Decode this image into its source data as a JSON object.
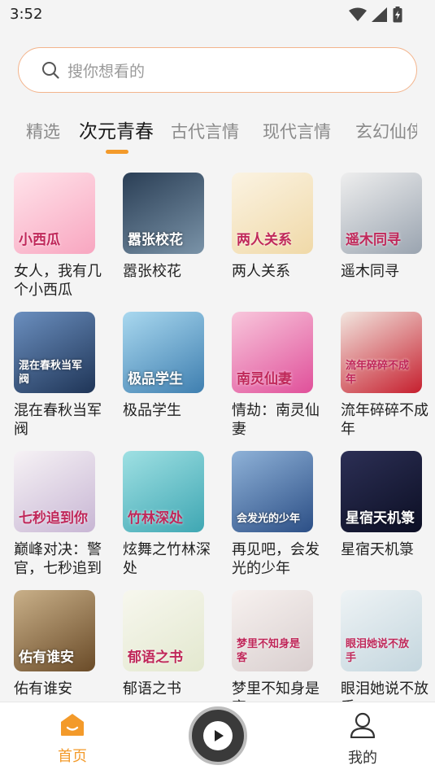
{
  "status": {
    "time": "3:52"
  },
  "search": {
    "placeholder": "搜你想看的"
  },
  "tabs": [
    {
      "label": "精选"
    },
    {
      "label": "次元青春"
    },
    {
      "label": "古代言情"
    },
    {
      "label": "现代言情"
    },
    {
      "label": "玄幻仙侠"
    }
  ],
  "books": [
    {
      "title": "女人，我有几个小西瓜",
      "cover_text": "小西瓜",
      "colors": [
        "#ffe3ea",
        "#f8a6c0"
      ]
    },
    {
      "title": "嚣张校花",
      "cover_text": "嚣张校花",
      "colors": [
        "#2a3e55",
        "#7a93a8"
      ]
    },
    {
      "title": "两人关系",
      "cover_text": "两人关系",
      "colors": [
        "#fbf3e2",
        "#f0d9a8"
      ]
    },
    {
      "title": "遥木同寻",
      "cover_text": "遥木同寻",
      "colors": [
        "#eeeeee",
        "#9aa4b0"
      ]
    },
    {
      "title": "混在春秋当军阀",
      "cover_text": "混在春秋当军阀",
      "colors": [
        "#6b8fbf",
        "#1f3557"
      ]
    },
    {
      "title": "极品学生",
      "cover_text": "极品学生",
      "colors": [
        "#a9d8ef",
        "#3f7fb0"
      ]
    },
    {
      "title": "情劫：南灵仙妻",
      "cover_text": "南灵仙妻",
      "colors": [
        "#f8c7dc",
        "#e0509a"
      ]
    },
    {
      "title": "流年碎碎不成年",
      "cover_text": "流年碎碎不成年",
      "colors": [
        "#f2e6df",
        "#c61f2e"
      ]
    },
    {
      "title": "巅峰对决：警官，七秒追到你",
      "cover_text": "七秒追到你",
      "colors": [
        "#f6f2f5",
        "#c8b6d4"
      ]
    },
    {
      "title": "炫舞之竹林深处",
      "cover_text": "竹林深处",
      "colors": [
        "#9fe0e3",
        "#3fa7b3"
      ]
    },
    {
      "title": "再见吧，会发光的少年",
      "cover_text": "会发光的少年",
      "colors": [
        "#8fb2d8",
        "#2c4f86"
      ]
    },
    {
      "title": "星宿天机箓",
      "cover_text": "星宿天机箓",
      "colors": [
        "#2c2f55",
        "#0c0f24"
      ]
    },
    {
      "title": "佑有谁安",
      "cover_text": "佑有谁安",
      "colors": [
        "#c9b089",
        "#6a4b28"
      ]
    },
    {
      "title": "郁语之书",
      "cover_text": "郁语之书",
      "colors": [
        "#f7f7ee",
        "#e3e8cf"
      ]
    },
    {
      "title": "梦里不知身是客",
      "cover_text": "梦里不知身是客",
      "colors": [
        "#f7f1ef",
        "#d9cfcf"
      ]
    },
    {
      "title": "眼泪她说不放手",
      "cover_text": "眼泪她说不放手",
      "colors": [
        "#eef3f5",
        "#c4d6de"
      ]
    }
  ],
  "nav": {
    "home_label": "首页",
    "mine_label": "我的",
    "accent": "#f39a2a",
    "inactive": "#333333"
  }
}
